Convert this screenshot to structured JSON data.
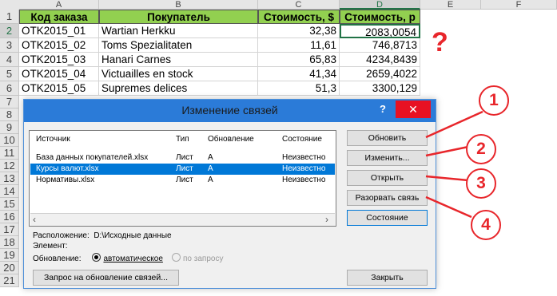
{
  "spreadsheet": {
    "columns": [
      "A",
      "B",
      "C",
      "D",
      "E",
      "F"
    ],
    "rows": [
      "1",
      "2",
      "3",
      "4",
      "5",
      "6",
      "7",
      "8",
      "9",
      "10",
      "11",
      "12",
      "13",
      "14",
      "15",
      "16",
      "17",
      "18",
      "19",
      "20",
      "21"
    ],
    "headers": [
      "Код заказа",
      "Покупатель",
      "Стоимость, $",
      "Стоимость, р"
    ],
    "data": [
      [
        "OTK2015_01",
        "Wartian Herkku",
        "32,38",
        "2083,0054"
      ],
      [
        "OTK2015_02",
        "Toms Spezialitaten",
        "11,61",
        "746,8713"
      ],
      [
        "OTK2015_03",
        "Hanari Carnes",
        "65,83",
        "4234,8439"
      ],
      [
        "OTK2015_04",
        "Victuailles en stock",
        "41,34",
        "2659,4022"
      ],
      [
        "OTK2015_05",
        "Supremes delices",
        "51,3",
        "3300,129"
      ]
    ],
    "question_mark": "?"
  },
  "dialog": {
    "title": "Изменение связей",
    "help": "?",
    "close": "✕",
    "columns": [
      "Источник",
      "Тип",
      "Обновление",
      "Состояние"
    ],
    "links": [
      {
        "source": "База данных покупателей.xlsx",
        "type": "Лист",
        "update": "A",
        "status": "Неизвестно"
      },
      {
        "source": "Курсы валют.xlsx",
        "type": "Лист",
        "update": "A",
        "status": "Неизвестно"
      },
      {
        "source": "Нормативы.xlsx",
        "type": "Лист",
        "update": "A",
        "status": "Неизвестно"
      }
    ],
    "selected_index": 1,
    "buttons": {
      "update": "Обновить",
      "change": "Изменить...",
      "open": "Открыть",
      "break": "Разорвать связь",
      "status": "Состояние",
      "startup": "Запрос на обновление связей...",
      "close": "Закрыть"
    },
    "location_label": "Расположение:",
    "location_value": "D:\\Исходные данные",
    "element_label": "Элемент:",
    "update_label": "Обновление:",
    "update_auto": "автоматическое",
    "update_manual": "по запросу"
  },
  "callouts": [
    "1",
    "2",
    "3",
    "4"
  ],
  "colors": {
    "header_fill": "#92d050",
    "dialog_title": "#2b7bd8",
    "selection": "#0078d7",
    "callout": "#e8262b"
  }
}
